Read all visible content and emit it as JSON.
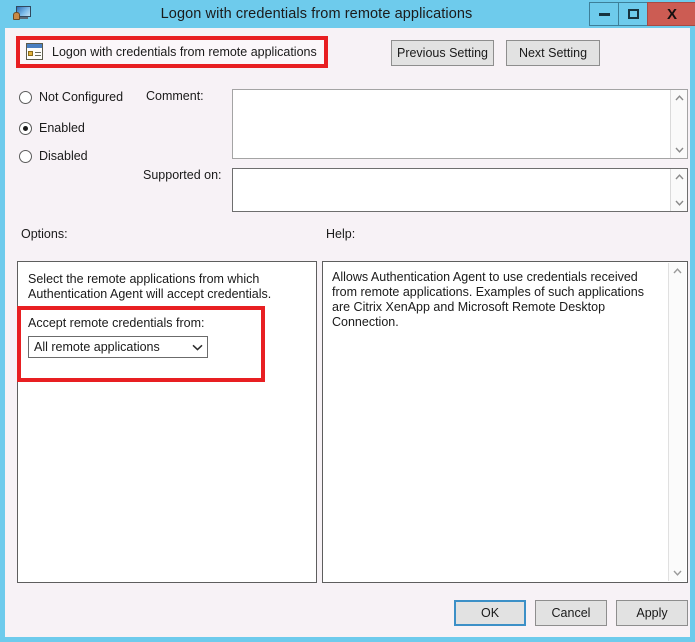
{
  "window": {
    "title": "Logon with credentials from remote applications",
    "app_icon": "computer-monitor-icon",
    "controls": {
      "minimize": "minimize-icon",
      "maximize": "maximize-icon",
      "close": "X"
    }
  },
  "header": {
    "setting_icon": "policy-setting-icon",
    "setting_name": "Logon with credentials from remote applications",
    "previous_setting": "Previous Setting",
    "next_setting": "Next Setting"
  },
  "state": {
    "options": [
      {
        "label": "Not Configured",
        "selected": false
      },
      {
        "label": "Enabled",
        "selected": true
      },
      {
        "label": "Disabled",
        "selected": false
      }
    ]
  },
  "fields": {
    "comment_label": "Comment:",
    "comment_value": "",
    "supported_label": "Supported on:",
    "supported_value": ""
  },
  "sections": {
    "options_label": "Options:",
    "help_label": "Help:"
  },
  "options_panel": {
    "description": "Select the remote applications from which Authentication Agent will accept credentials.",
    "dropdown_label": "Accept remote credentials from:",
    "dropdown_value": "All remote applications",
    "dropdown_arrow": "chevron-down-icon"
  },
  "help_panel": {
    "text": "Allows Authentication Agent to use credentials received from remote applications.  Examples of such applications are Citrix XenApp and Microsoft Remote Desktop Connection."
  },
  "footer": {
    "ok": "OK",
    "cancel": "Cancel",
    "apply": "Apply"
  },
  "colors": {
    "titlebar": "#6ECBEC",
    "close_button": "#CC5C53",
    "highlight": "#E81F22",
    "dialog_bg": "#F7F2F6",
    "default_button_focus": "#3C90C7"
  }
}
